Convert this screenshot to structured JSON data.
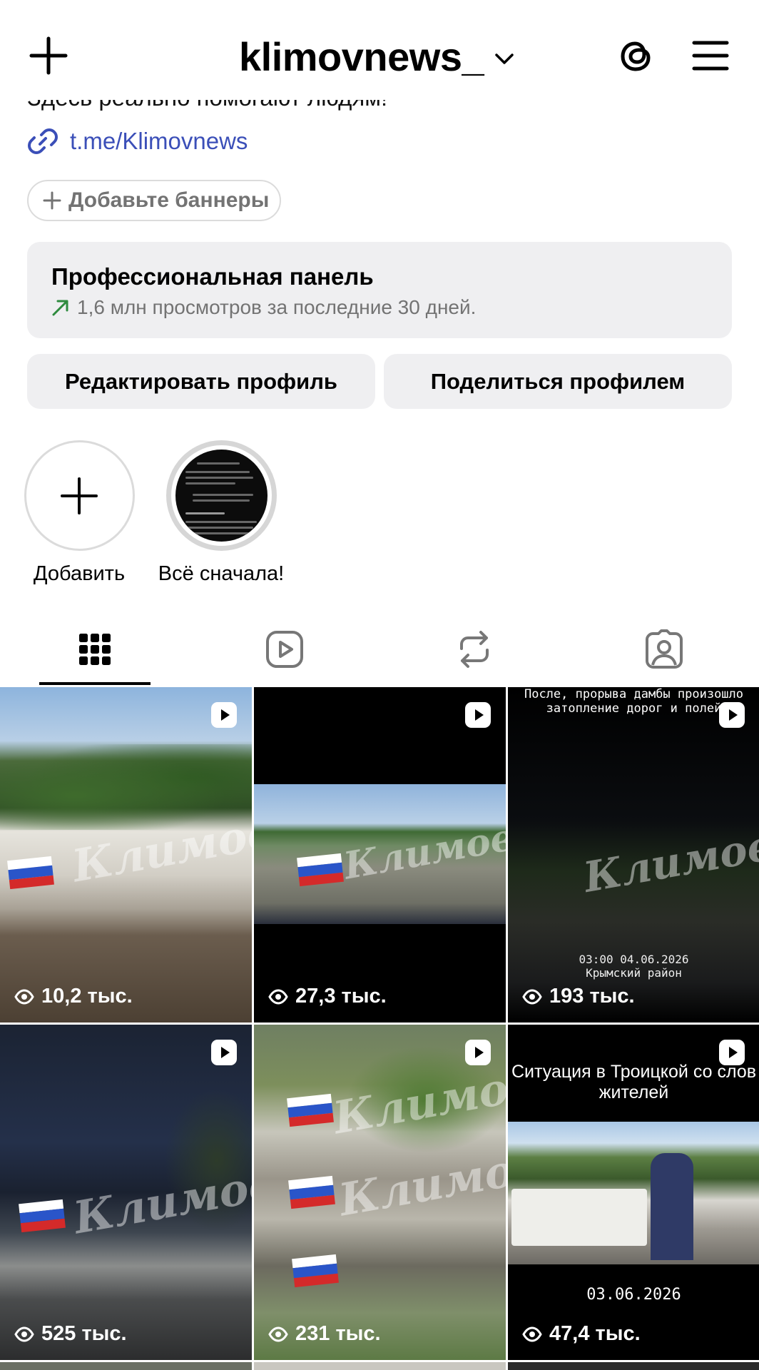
{
  "header": {
    "username": "klimovnews_"
  },
  "bio": {
    "line": "Здесь реально помогают людям!",
    "link": "t.me/Klimovnews"
  },
  "banner_button": {
    "label": "Добавьте баннеры"
  },
  "pro_panel": {
    "title": "Профессиональная панель",
    "subtitle": "1,6 млн просмотров за последние 30 дней."
  },
  "actions": {
    "edit_label": "Редактировать профиль",
    "share_label": "Поделиться профилем"
  },
  "highlights": [
    {
      "label": "Добавить"
    },
    {
      "label": "Всё сначала!"
    }
  ],
  "tabs": [
    {
      "icon": "grid-icon",
      "active": true
    },
    {
      "icon": "reels-icon",
      "active": false
    },
    {
      "icon": "repost-icon",
      "active": false
    },
    {
      "icon": "tagged-icon",
      "active": false
    }
  ],
  "posts": [
    {
      "views": "10,2 тыс.",
      "watermark": "Климов"
    },
    {
      "views": "27,3 тыс.",
      "watermark": "Климов"
    },
    {
      "views": "193 тыс.",
      "caption": "После, прорыва дамбы произошло затопление дорог и полей",
      "stamp_time": "03:00 04.06.2026",
      "stamp_place": "Крымский район",
      "watermark": "Климов"
    },
    {
      "views": "525 тыс.",
      "watermark": "Климов"
    },
    {
      "views": "231 тыс.",
      "watermark": "Климов"
    },
    {
      "views": "47,4 тыс.",
      "caption": "Ситуация в Троицкой со слов жителей",
      "date": "03.06.2026"
    }
  ],
  "colors": {
    "link": "#3b4fb8",
    "panel_bg": "#efeff1",
    "muted_text": "#737373",
    "trend_arrow": "#2e8b3e"
  }
}
